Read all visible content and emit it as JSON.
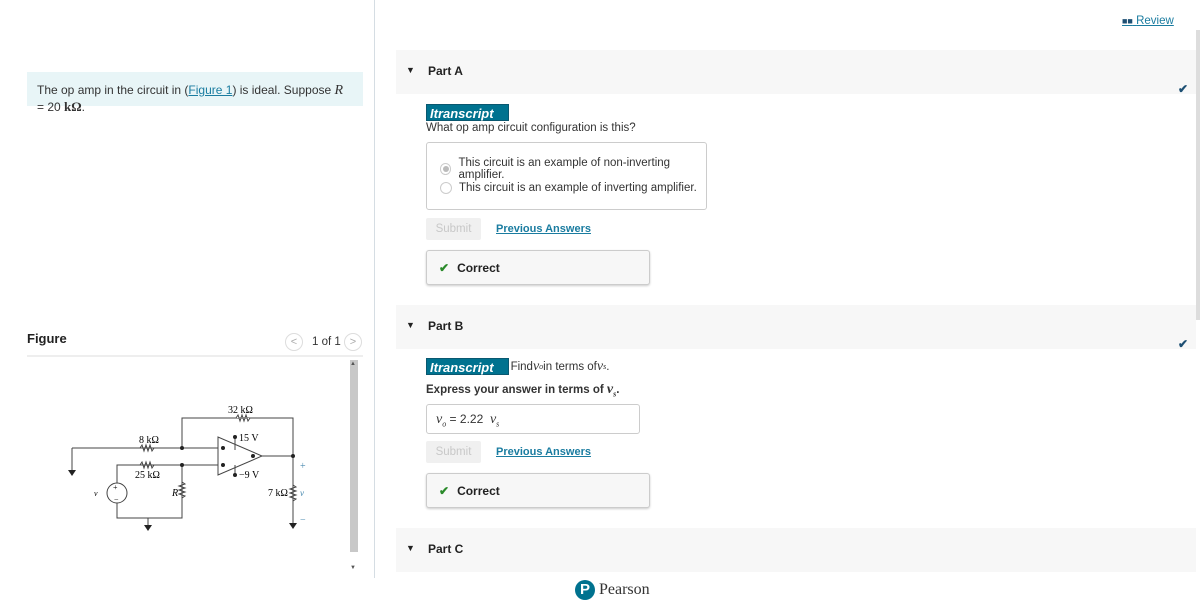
{
  "review": {
    "label": "Review",
    "icon": "book-icon"
  },
  "intro": {
    "before": "The op amp in the circuit in (",
    "link": "Figure 1",
    "after": ") is ideal. Suppose ",
    "var": "R",
    "eq": " = 20 ",
    "unit": "kΩ",
    "period": "."
  },
  "figure": {
    "title": "Figure",
    "pager": "1 of 1",
    "prev": "<",
    "next": ">",
    "labels": {
      "r32": "32 kΩ",
      "r8": "8 kΩ",
      "r25": "25 kΩ",
      "v15": "15 V",
      "vm9": "−9 V",
      "r": "R",
      "r7": "7 kΩ",
      "vs": "v",
      "vs_sub": "s",
      "vo": "v",
      "vo_sub": "o",
      "plus": "+",
      "minus": "−"
    }
  },
  "partA": {
    "label": "Part A",
    "badge": "Itranscript",
    "question": "What op amp circuit configuration is this?",
    "choices": [
      "This circuit is an example of non-inverting amplifier.",
      "This circuit is an example of inverting amplifier."
    ],
    "selected": 0,
    "submit": "Submit",
    "previous": "Previous Answers",
    "result": "Correct"
  },
  "partB": {
    "label": "Part B",
    "badge": "Itranscript",
    "q_before": "Find ",
    "q_var1": "v",
    "q_sub1": "o",
    "q_mid": " in terms of ",
    "q_var2": "v",
    "q_sub2": "s",
    "q_end": ".",
    "instr": "Express your answer in terms of ",
    "instr_var": "v",
    "instr_sub": "s",
    "instr_end": ".",
    "answer_lhs": "v",
    "answer_lhs_sub": "o",
    "answer_eq": " = ",
    "answer_value": "2.22",
    "answer_var": "v",
    "answer_var_sub": "s",
    "submit": "Submit",
    "previous": "Previous Answers",
    "result": "Correct"
  },
  "partC": {
    "label": "Part C"
  },
  "footer": {
    "brand": "Pearson"
  },
  "colors": {
    "accent": "#00728f",
    "link": "#1a7ca0",
    "correct": "#2a8a2a"
  }
}
